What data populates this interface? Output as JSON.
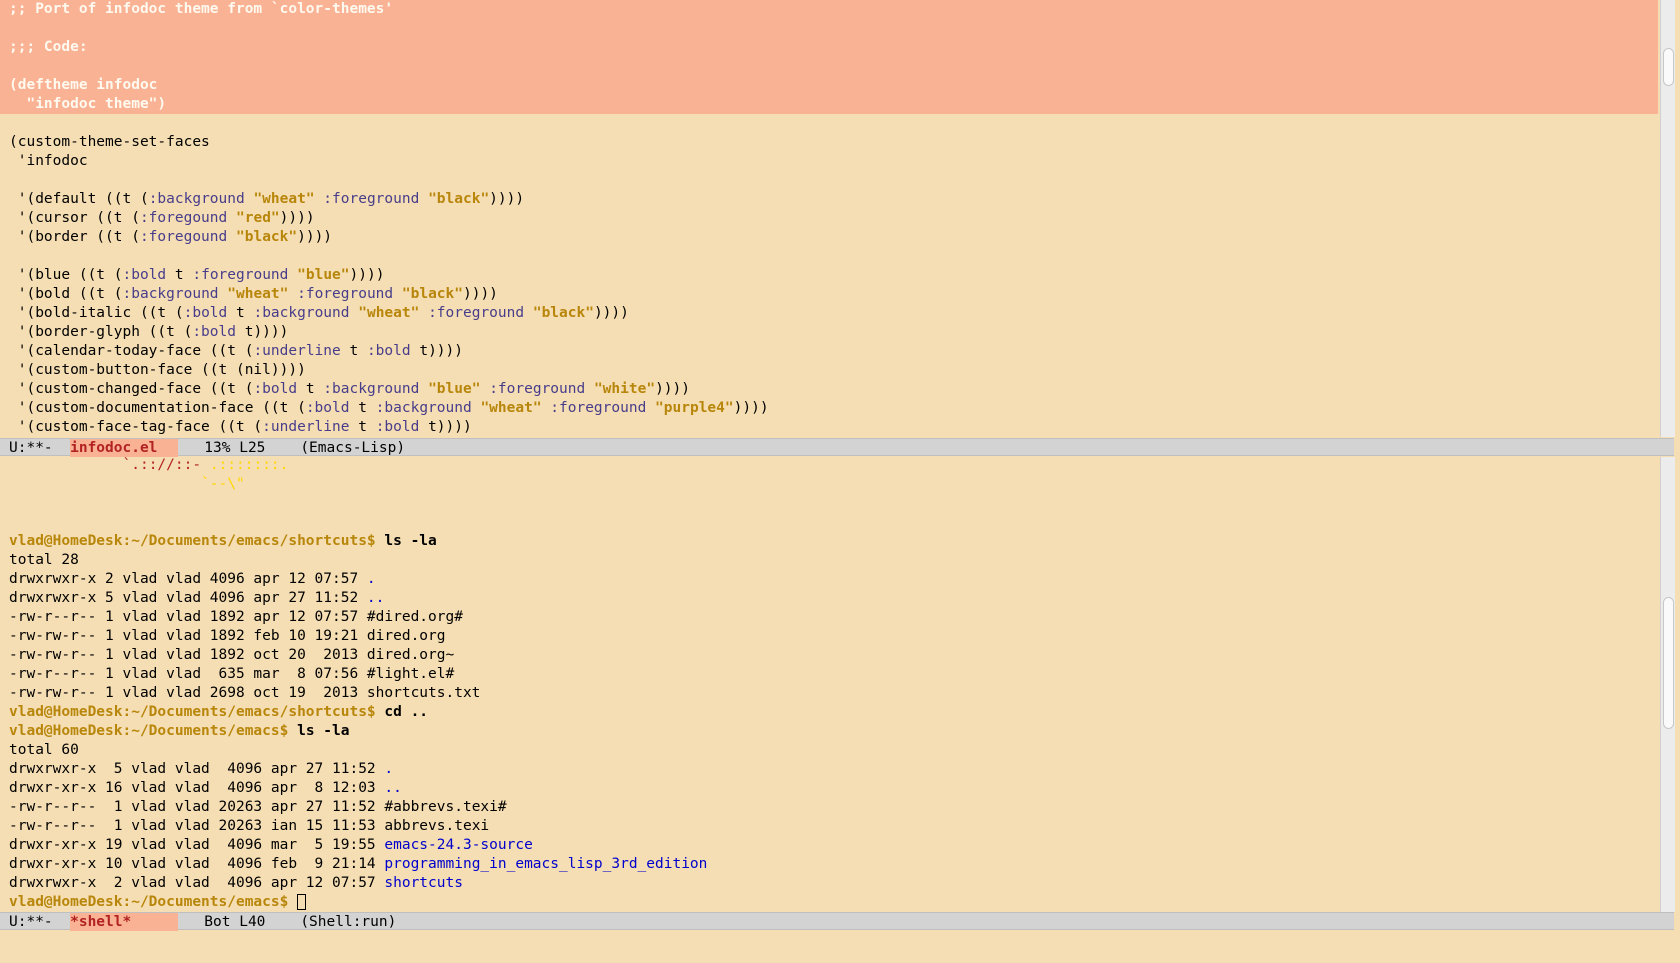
{
  "top_buffer": {
    "header_lines": [
      ";; Port of infodoc theme from `color-themes'",
      "",
      ";;; Code:",
      "",
      "(deftheme infodoc",
      "  \"infodoc theme\")"
    ],
    "code": {
      "line1": "(custom-theme-set-faces",
      "line2": " 'infodoc",
      "d_a": " '(default ((t (",
      "d_k1": ":background",
      "d_s1": "\"wheat\"",
      "d_k2": ":foreground",
      "d_s2": "\"black\"",
      "d_end": "))))",
      "c_a": " '(cursor ((t (",
      "c_k1": ":foregound",
      "c_s1": "\"red\"",
      "c_end": "))))",
      "b_a": " '(border ((t (",
      "b_k1": ":foregound",
      "b_s1": "\"black\"",
      "b_end": "))))",
      "bl_a": " '(blue ((t (",
      "bl_k1": ":bold",
      "bl_t1": " t ",
      "bl_k2": ":foreground",
      "bl_s1": "\"blue\"",
      "bl_end": "))))",
      "bo_a": " '(bold ((t (",
      "bo_k1": ":background",
      "bo_s1": "\"wheat\"",
      "bo_k2": ":foreground",
      "bo_s2": "\"black\"",
      "bo_end": "))))",
      "bi_a": " '(bold-italic ((t (",
      "bi_k1": ":bold",
      "bi_t1": " t ",
      "bi_k2": ":background",
      "bi_s1": "\"wheat\"",
      "bi_k3": ":foreground",
      "bi_s2": "\"black\"",
      "bi_end": "))))",
      "bg_a": " '(border-glyph ((t (",
      "bg_k1": ":bold",
      "bg_end": " t))))",
      "ct_a": " '(calendar-today-face ((t (",
      "ct_k1": ":underline",
      "ct_t1": " t ",
      "ct_k2": ":bold",
      "ct_end": " t))))",
      "cb": " '(custom-button-face ((t (nil))))",
      "cc_a": " '(custom-changed-face ((t (",
      "cc_k1": ":bold",
      "cc_t1": " t ",
      "cc_k2": ":background",
      "cc_s1": "\"blue\"",
      "cc_k3": ":foreground",
      "cc_s2": "\"white\"",
      "cc_end": "))))",
      "cd_a": " '(custom-documentation-face ((t (",
      "cd_k1": ":bold",
      "cd_t1": " t ",
      "cd_k2": ":background",
      "cd_s1": "\"wheat\"",
      "cd_k3": ":foreground",
      "cd_s2": "\"purple4\"",
      "cd_end": "))))",
      "cf_a": " '(custom-face-tag-face ((t (",
      "cf_k1": ":underline",
      "cf_t1": " t ",
      "cf_k2": ":bold",
      "cf_end": " t))))"
    }
  },
  "modeline_top": {
    "status": "U:**-  ",
    "buffer": "infodoc.el",
    "position": "   13% L25    ",
    "mode": "(Emacs-Lisp)"
  },
  "shell": {
    "logo_red": "`.:://::- ",
    "logo_yellow1": ".:::::::.",
    "logo_yellow2": "`--\\\"",
    "prompt1": "vlad@HomeDesk:~/Documents/emacs/shortcuts$",
    "cmd1": " ls -la",
    "listing1": {
      "total": "total 28",
      "rows": [
        {
          "meta": "drwxrwxr-x 2 vlad vlad 4096 apr 12 07:57 ",
          "name": "."
        },
        {
          "meta": "drwxrwxr-x 5 vlad vlad 4096 apr 27 11:52 ",
          "name": ".."
        },
        {
          "meta": "-rw-r--r-- 1 vlad vlad 1892 apr 12 07:57 ",
          "name": "#dired.org#"
        },
        {
          "meta": "-rw-rw-r-- 1 vlad vlad 1892 feb 10 19:21 ",
          "name": "dired.org"
        },
        {
          "meta": "-rw-rw-r-- 1 vlad vlad 1892 oct 20  2013 ",
          "name": "dired.org~"
        },
        {
          "meta": "-rw-r--r-- 1 vlad vlad  635 mar  8 07:56 ",
          "name": "#light.el#"
        },
        {
          "meta": "-rw-rw-r-- 1 vlad vlad 2698 oct 19  2013 ",
          "name": "shortcuts.txt"
        }
      ]
    },
    "prompt2": "vlad@HomeDesk:~/Documents/emacs/shortcuts$",
    "cmd2": " cd ..",
    "prompt3": "vlad@HomeDesk:~/Documents/emacs$",
    "cmd3": " ls -la",
    "listing2": {
      "total": "total 60",
      "rows": [
        {
          "meta": "drwxrwxr-x  5 vlad vlad  4096 apr 27 11:52 ",
          "name": "."
        },
        {
          "meta": "drwxr-xr-x 16 vlad vlad  4096 apr  8 12:03 ",
          "name": ".."
        },
        {
          "meta": "-rw-r--r--  1 vlad vlad 20263 apr 27 11:52 ",
          "name": "#abbrevs.texi#"
        },
        {
          "meta": "-rw-r--r--  1 vlad vlad 20263 ian 15 11:53 ",
          "name": "abbrevs.texi"
        },
        {
          "meta": "drwxr-xr-x 19 vlad vlad  4096 mar  5 19:55 ",
          "name": "emacs-24.3-source"
        },
        {
          "meta": "drwxr-xr-x 10 vlad vlad  4096 feb  9 21:14 ",
          "name": "programming_in_emacs_lisp_3rd_edition"
        },
        {
          "meta": "drwxrwxr-x  2 vlad vlad  4096 apr 12 07:57 ",
          "name": "shortcuts"
        }
      ]
    },
    "prompt4": "vlad@HomeDesk:~/Documents/emacs$"
  },
  "modeline_bottom": {
    "status": "U:**-  ",
    "buffer": "*shell*",
    "position": "   Bot L40    ",
    "mode": "(Shell:run)"
  }
}
